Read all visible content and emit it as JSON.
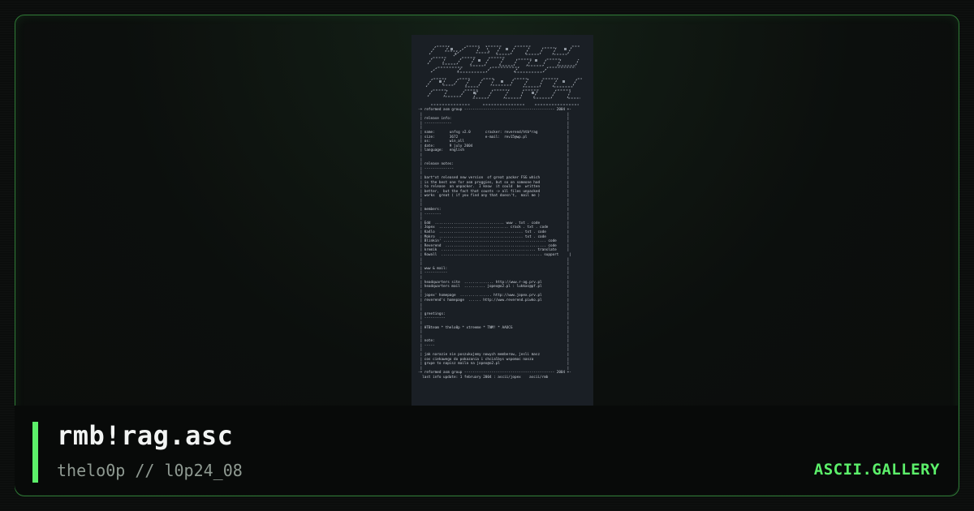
{
  "artwork": {
    "lines": [
      "-+ reformed asm group ------------------------------------------- 2004 +-",
      " |                                                                     |",
      " | release info:                                                       |",
      " | -------------                                                       |",
      " |                                                                     |",
      " | name:       unfsg v2.0       cracker: reverend/htb*rag              |",
      " | size:       3672             e-mail:  rev15@wp.pl                   |",
      " | os:         win_all                                                 |",
      " | date:       9 july 2004                                             |",
      " | language:   english                                                 |",
      " |                                                                     |",
      " |                                                                     |",
      " | release notes:                                                      |",
      " | --------------                                                      |",
      " |                                                                     |",
      " | bart^xt released new version  of great packer FSG which             |",
      " | is the best one for asm proggies, but so on someone had             |",
      " | to release  an unpacker.  I know  it could  be  written             |",
      " | better,  but the fact that counts -> all files unpacked             |",
      " | works  great ( if you find any that doesn't,  mail me )             |",
      " |                                                                     |",
      " |                                                                     |",
      " | members:                                                            |",
      " | --------                                                            |",
      " |                                                                     |",
      " | Edd  ................................. www . txt . code             |",
      " | Jopex  ................................. crack . txt . code         |",
      " | Ka4lo  ........................................ txt . code          |",
      " | Mokro  ........................................ txt . code          |",
      " | Blinkin' ................................................. code     |",
      " | Reverend  ................................................ code     |",
      " | kremik  ............................................. translate     |",
      " | Kowall  ................................................ support     |",
      " |                                                                     |",
      " |                                                                     |",
      " | www & mail:                                                         |",
      " | -----------                                                         |",
      " |                                                                     |",
      " | headquarters site  .............. http://www.r-ag.prv.pl            |",
      " | headquarters mail  .......... jopex@o2.pl : lukkas@pf.pl            |",
      " |                                                                     |",
      " | jopex' homepage  ............... http://www.jopex.prv.pl            |",
      " | reverend's homepage  ...... http://www.reverend.piwko.pl            |",
      " |                                                                     |",
      " |                                                                     |",
      " | greetings:                                                          |",
      " | ----------                                                          |",
      " |                                                                     |",
      " | HTBteam * thelo0p * xtreeme * TNM! * AAOCG                          |",
      " |                                                                     |",
      " |                                                                     |",
      " | note:                                                               |",
      " | -----                                                               |",
      " |                                                                     |",
      " | jak narazie nie poszukujemy nowych memberow, jesli masz             |",
      " | cos ciekawego do pokazania i chcialbys wspomoc nasza                |",
      " | grupe to napisz maila na jopex@o2.pl                                |",
      " |                                                                     |",
      "-+ reformed asm group ------------------------------------------- 2004 +-",
      "  last info update: 1 february 2004 : ascii/jopex    ascii/rmb"
    ]
  },
  "footer": {
    "title": "rmb!rag.asc",
    "subtitle": "thelo0p // l0p24_08",
    "brand": "ASCII.GALLERY"
  },
  "colors": {
    "accent": "#5cf06a",
    "frame_border": "#2f7a36",
    "panel_bg": "#1a1f25",
    "art_text": "#c9ced6"
  }
}
